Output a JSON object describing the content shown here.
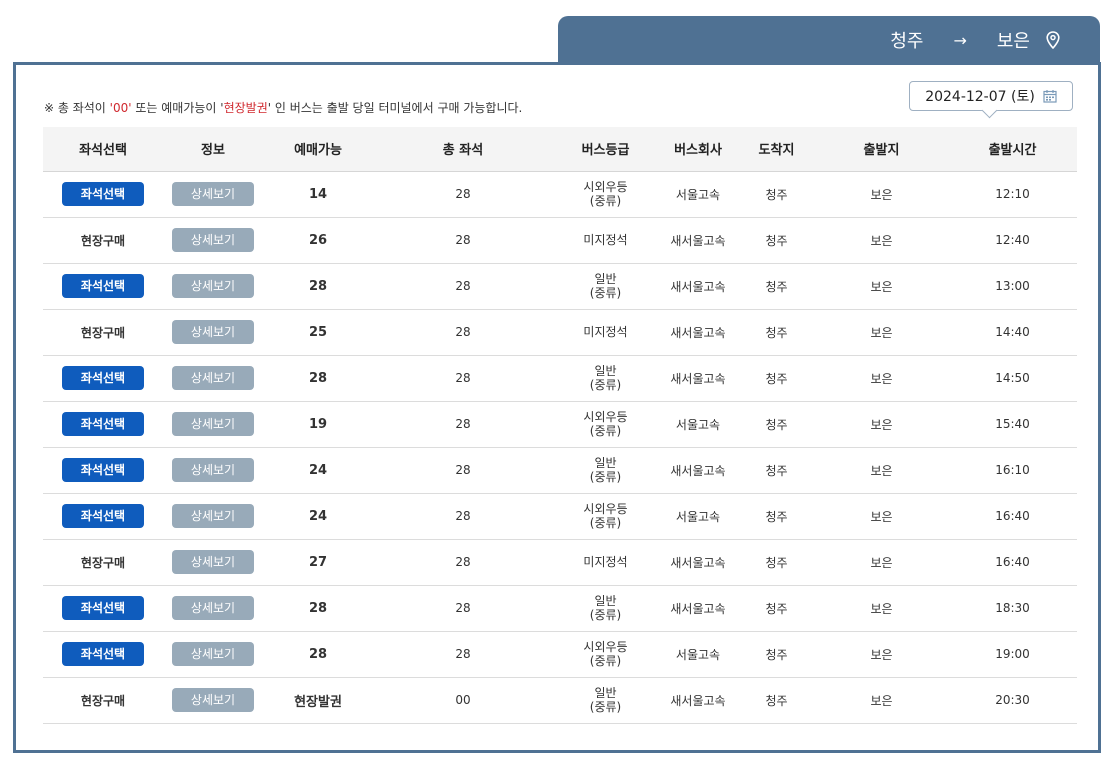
{
  "route": {
    "origin": "보은",
    "arrow": "→",
    "destination": "청주"
  },
  "notice": {
    "prefix": "※ 총 좌석이 ",
    "highlight_00": "'00'",
    "middle": " 또는 예매가능이 '",
    "highlight_onsite": "현장발권",
    "suffix": "' 인 버스는 출발 당일 터미널에서 구매 가능합니다."
  },
  "date": {
    "value": "2024-12-07 (토)"
  },
  "table": {
    "headers": [
      "출발시간",
      "출발지",
      "도착지",
      "버스회사",
      "버스등급",
      "총 좌석",
      "예매가능",
      "정보",
      "좌석선택"
    ],
    "rows": [
      {
        "time": "12:10",
        "from": "보은",
        "to": "청주",
        "company": "서울고속",
        "grade1": "시외우등",
        "grade2": "(중류)",
        "total": "28",
        "avail": "14",
        "info": "상세보기",
        "action": "좌석선택",
        "type": "seat"
      },
      {
        "time": "12:40",
        "from": "보은",
        "to": "청주",
        "company": "새서울고속",
        "grade1": "미지정석",
        "grade2": "",
        "total": "28",
        "avail": "26",
        "info": "상세보기",
        "action": "현장구매",
        "type": "onsite"
      },
      {
        "time": "13:00",
        "from": "보은",
        "to": "청주",
        "company": "새서울고속",
        "grade1": "일반",
        "grade2": "(중류)",
        "total": "28",
        "avail": "28",
        "info": "상세보기",
        "action": "좌석선택",
        "type": "seat"
      },
      {
        "time": "14:40",
        "from": "보은",
        "to": "청주",
        "company": "새서울고속",
        "grade1": "미지정석",
        "grade2": "",
        "total": "28",
        "avail": "25",
        "info": "상세보기",
        "action": "현장구매",
        "type": "onsite"
      },
      {
        "time": "14:50",
        "from": "보은",
        "to": "청주",
        "company": "새서울고속",
        "grade1": "일반",
        "grade2": "(중류)",
        "total": "28",
        "avail": "28",
        "info": "상세보기",
        "action": "좌석선택",
        "type": "seat"
      },
      {
        "time": "15:40",
        "from": "보은",
        "to": "청주",
        "company": "서울고속",
        "grade1": "시외우등",
        "grade2": "(중류)",
        "total": "28",
        "avail": "19",
        "info": "상세보기",
        "action": "좌석선택",
        "type": "seat"
      },
      {
        "time": "16:10",
        "from": "보은",
        "to": "청주",
        "company": "새서울고속",
        "grade1": "일반",
        "grade2": "(중류)",
        "total": "28",
        "avail": "24",
        "info": "상세보기",
        "action": "좌석선택",
        "type": "seat"
      },
      {
        "time": "16:40",
        "from": "보은",
        "to": "청주",
        "company": "서울고속",
        "grade1": "시외우등",
        "grade2": "(중류)",
        "total": "28",
        "avail": "24",
        "info": "상세보기",
        "action": "좌석선택",
        "type": "seat"
      },
      {
        "time": "16:40",
        "from": "보은",
        "to": "청주",
        "company": "새서울고속",
        "grade1": "미지정석",
        "grade2": "",
        "total": "28",
        "avail": "27",
        "info": "상세보기",
        "action": "현장구매",
        "type": "onsite"
      },
      {
        "time": "18:30",
        "from": "보은",
        "to": "청주",
        "company": "새서울고속",
        "grade1": "일반",
        "grade2": "(중류)",
        "total": "28",
        "avail": "28",
        "info": "상세보기",
        "action": "좌석선택",
        "type": "seat"
      },
      {
        "time": "19:00",
        "from": "보은",
        "to": "청주",
        "company": "서울고속",
        "grade1": "시외우등",
        "grade2": "(중류)",
        "total": "28",
        "avail": "28",
        "info": "상세보기",
        "action": "좌석선택",
        "type": "seat"
      },
      {
        "time": "20:30",
        "from": "보은",
        "to": "청주",
        "company": "새서울고속",
        "grade1": "일반",
        "grade2": "(중류)",
        "total": "00",
        "avail": "현장발권",
        "info": "상세보기",
        "action": "현장구매",
        "type": "onsite"
      }
    ]
  },
  "colors": {
    "header_tab": "#4f7193",
    "seat_button": "#0f5cbd",
    "detail_button": "#98aab9",
    "highlight_red": "#d0282e"
  },
  "icons": {
    "route_pin": "map-pin-icon",
    "date": "calendar-icon"
  }
}
